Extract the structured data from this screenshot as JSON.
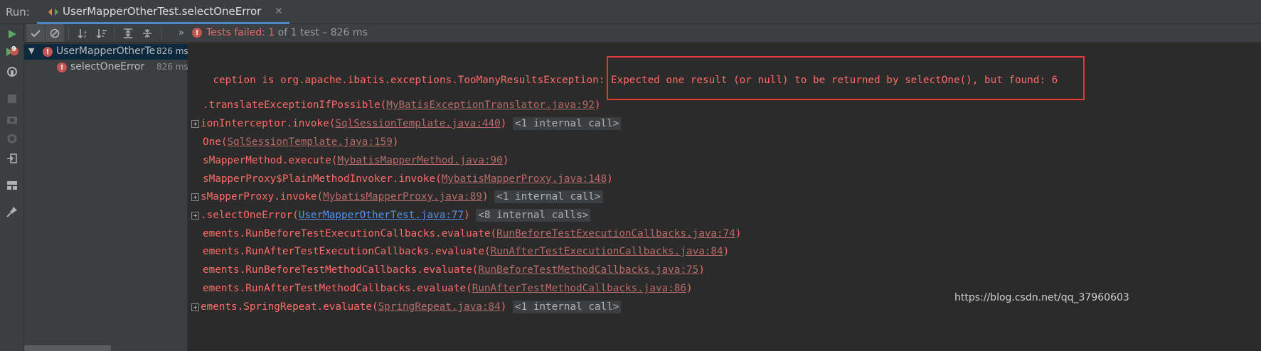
{
  "run_bar": {
    "label": "Run:",
    "tab_title": "UserMapperOtherTest.selectOneError",
    "close_glyph": "✕"
  },
  "toolbar": {
    "status_failed": "Tests failed:",
    "status_count": "1",
    "status_rest": "of 1 test – 826 ms"
  },
  "tree": {
    "items": [
      {
        "name": "UserMapperOtherTes",
        "time": "826 ms"
      },
      {
        "name": "selectOneError",
        "time": "826 ms"
      }
    ]
  },
  "left_toolbar": {
    "badge_count": "9"
  },
  "console": {
    "lines": [
      {
        "text": "ception is org.apache.ibatis.exceptions.TooManyResultsException: Expected one result (or null) to be returned by selectOne(), but found: 6"
      },
      {
        "prefix": ".translateExceptionIfPossible(",
        "link": "MyBatisExceptionTranslator.java:92",
        "suffix": ")"
      },
      {
        "prefix": "ionInterceptor.invoke(",
        "link": "SqlSessionTemplate.java:440",
        "suffix": ")",
        "internal": "<1 internal call>"
      },
      {
        "prefix": "One(",
        "link": "SqlSessionTemplate.java:159",
        "suffix": ")"
      },
      {
        "prefix": "sMapperMethod.execute(",
        "link": "MybatisMapperMethod.java:90",
        "suffix": ")"
      },
      {
        "prefix": "sMapperProxy$PlainMethodInvoker.invoke(",
        "link": "MybatisMapperProxy.java:148",
        "suffix": ")"
      },
      {
        "prefix": "sMapperProxy.invoke(",
        "link": "MybatisMapperProxy.java:89",
        "suffix": ")",
        "internal": "<1 internal call>"
      },
      {
        "prefix": ".selectOneError(",
        "link": "UserMapperOtherTest.java:77",
        "suffix": ")",
        "internal": "<8 internal calls>"
      },
      {
        "prefix": "ements.RunBeforeTestExecutionCallbacks.evaluate(",
        "link": "RunBeforeTestExecutionCallbacks.java:74",
        "suffix": ")"
      },
      {
        "prefix": "ements.RunAfterTestExecutionCallbacks.evaluate(",
        "link": "RunAfterTestExecutionCallbacks.java:84",
        "suffix": ")"
      },
      {
        "prefix": "ements.RunBeforeTestMethodCallbacks.evaluate(",
        "link": "RunBeforeTestMethodCallbacks.java:75",
        "suffix": ")"
      },
      {
        "prefix": "ements.RunAfterTestMethodCallbacks.evaluate(",
        "link": "RunAfterTestMethodCallbacks.java:86",
        "suffix": ")"
      },
      {
        "prefix": "ements.SpringRepeat.evaluate(",
        "link": "SpringRepeat.java:84",
        "suffix": ")",
        "internal": "<1 internal call>"
      }
    ]
  },
  "watermark": "https://blog.csdn.net/qq_37960603",
  "colors": {
    "error_red": "#ff6b68",
    "link_blue": "#5394ec",
    "highlight_border": "#e53935",
    "tab_underline": "#4a88c7"
  }
}
